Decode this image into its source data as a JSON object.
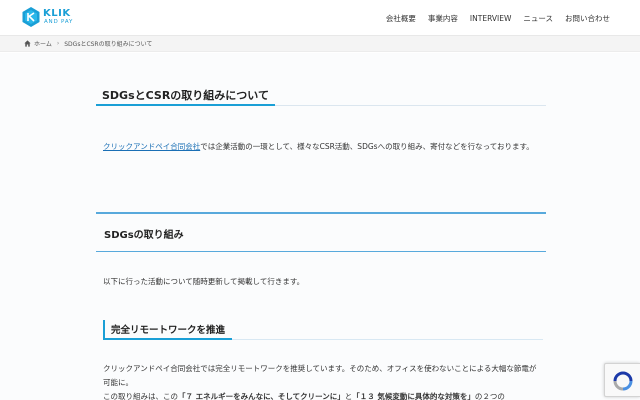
{
  "header": {
    "logo_text": "KLIK",
    "logo_sub": "AND PAY",
    "nav": [
      "会社概要",
      "事業内容",
      "INTERVIEW",
      "ニュース",
      "お問い合わせ"
    ]
  },
  "breadcrumb": {
    "home": "ホーム",
    "current": "SDGsとCSRの取り組みについて"
  },
  "page": {
    "title": "SDGsとCSRの取り組みについて",
    "intro_link": "クリックアンドペイ合同会社",
    "intro_rest": "では企業活動の一環として、様々なCSR活動、SDGsへの取り組み、寄付などを行なっております。",
    "section_title": "SDGsの取り組み",
    "section_text": "以下に行った活動について随時更新して掲載して行きます。",
    "sub_title": "完全リモートワークを推進",
    "sub_text": "クリックアンドペイ合同会社では完全リモートワークを推奨しています。そのため、オフィスを使わないことによる大幅な節電が可能に。",
    "sub_text2_a": "この取り組みは、この",
    "sub_text2_b": "「７ エネルギーをみんなに、そしてクリーンに」",
    "sub_text2_c": "と",
    "sub_text2_d": "「１３ 気候変動に具体的な対策を」",
    "sub_text2_e": "の２つの"
  },
  "colors": {
    "accent": "#1a9fd6",
    "link": "#1a6fb5"
  }
}
